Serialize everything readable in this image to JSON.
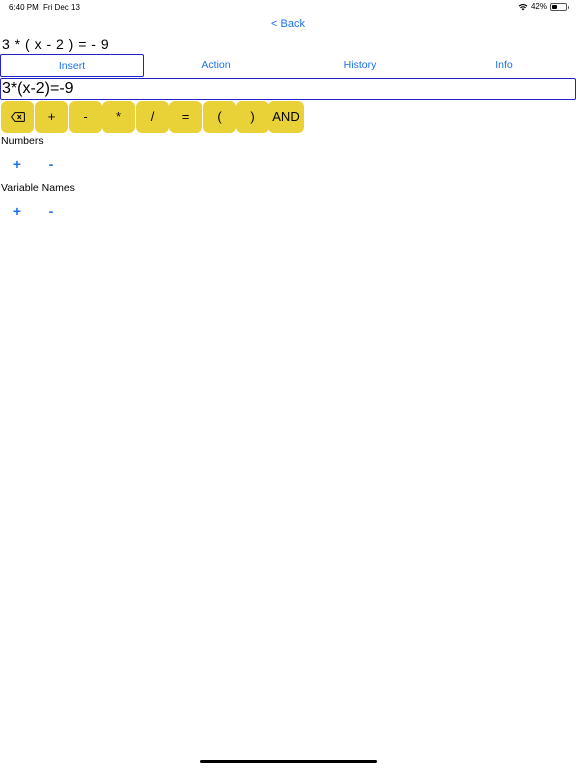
{
  "status_bar": {
    "time": "6:40 PM",
    "date": "Fri Dec 13",
    "battery": "42%",
    "battery_level": 0.42
  },
  "nav": {
    "back_label": "< Back"
  },
  "expression_display": "3 * ( x - 2 ) = - 9",
  "tabs": [
    {
      "label": "Insert",
      "active": true
    },
    {
      "label": "Action",
      "active": false
    },
    {
      "label": "History",
      "active": false
    },
    {
      "label": "Info",
      "active": false
    }
  ],
  "expression_input": {
    "value": "3*(x-2)=-9"
  },
  "keys": [
    {
      "icon": "backspace-icon"
    },
    {
      "label": "+"
    },
    {
      "label": "-"
    },
    {
      "label": "*"
    },
    {
      "label": "/"
    },
    {
      "label": "="
    },
    {
      "label": "("
    },
    {
      "label": ")"
    },
    {
      "label": "AND"
    }
  ],
  "sections": [
    {
      "label": "Numbers",
      "add": "+",
      "remove": "-"
    },
    {
      "label": "Variable Names",
      "add": "+",
      "remove": "-"
    }
  ],
  "colors": {
    "accent": "#1a73e8",
    "key_bg": "#e9d138",
    "border": "#2222cc"
  }
}
